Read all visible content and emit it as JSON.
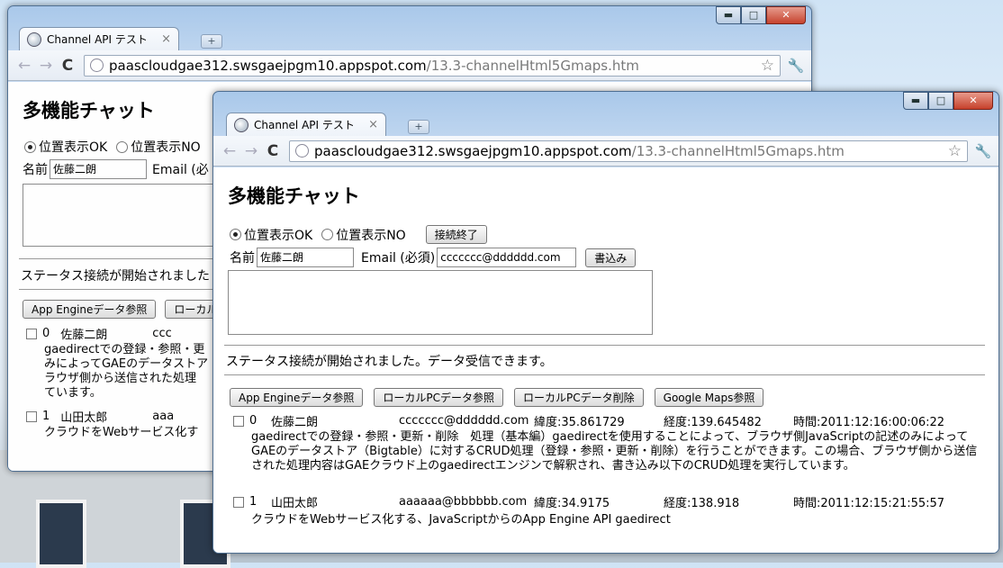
{
  "browser": {
    "tab_title": "Channel API テスト",
    "tab_close": "×",
    "new_tab": "+",
    "url_host": "paascloudgae312.swsgaejpgm10.appspot.com",
    "url_path": "/13.3-channelHtml5Gmaps.htm",
    "back_icon": "←",
    "forward_icon": "→",
    "reload_icon": "C",
    "star_icon": "☆",
    "wrench_icon": "🔧",
    "min_icon": "▬",
    "max_icon": "□",
    "close_icon": "✕"
  },
  "app": {
    "title": "多機能チャット",
    "radio_ok": "位置表示OK",
    "radio_no": "位置表示NO",
    "disconnect_button": "接続終了",
    "name_label": "名前",
    "name_value": "佐藤二朗",
    "email_label": "Email (必須)",
    "email_value": "ccccccc@dddddd.com",
    "write_button": "書込み",
    "status_text": "ステータス接続が開始されました。データ受信できます。",
    "buttons": {
      "app_engine": "App Engineデータ参照",
      "local_view": "ローカルPCデータ参照",
      "local_delete": "ローカルPCデータ削除",
      "maps": "Google Maps参照"
    },
    "messages": [
      {
        "index": "0",
        "name": "佐藤二朗",
        "email": "ccccccc@dddddd.com",
        "lat": "緯度:35.861729",
        "lng": "経度:139.645482",
        "time": "時間:2011:12:16:00:06:22",
        "body": "gaedirectでの登録・参照・更新・削除　処理（基本編）gaedirectを使用することによって、ブラウザ側JavaScriptの記述のみによってGAEのデータストア（Bigtable）に対するCRUD処理（登録・参照・更新・削除）を行うことができます。この場合、ブラウザ側から送信された処理内容はGAEクラウド上のgaedirectエンジンで解釈され、書き込み以下のCRUD処理を実行しています。"
      },
      {
        "index": "1",
        "name": "山田太郎",
        "email": "aaaaaa@bbbbbb.com",
        "lat": "緯度:34.9175",
        "lng": "経度:138.918",
        "time": "時間:2011:12:15:21:55:57",
        "body": "クラウドをWebサービス化する、JavaScriptからのApp Engine API gaedirect"
      }
    ]
  },
  "back_window": {
    "email_label_partial": "Email (必",
    "status_partial": "ステータス接続が開始されました",
    "local_button_partial": "ローカル",
    "msg0_email_partial": "ccc",
    "msg0_body_partial": "gaedirectでの登録・参照・更\nみによってGAEのデータストア\nラウザ側から送信された処理\nています。",
    "msg1_email_partial": "aaa",
    "msg1_body_partial": "クラウドをWebサービス化す"
  }
}
